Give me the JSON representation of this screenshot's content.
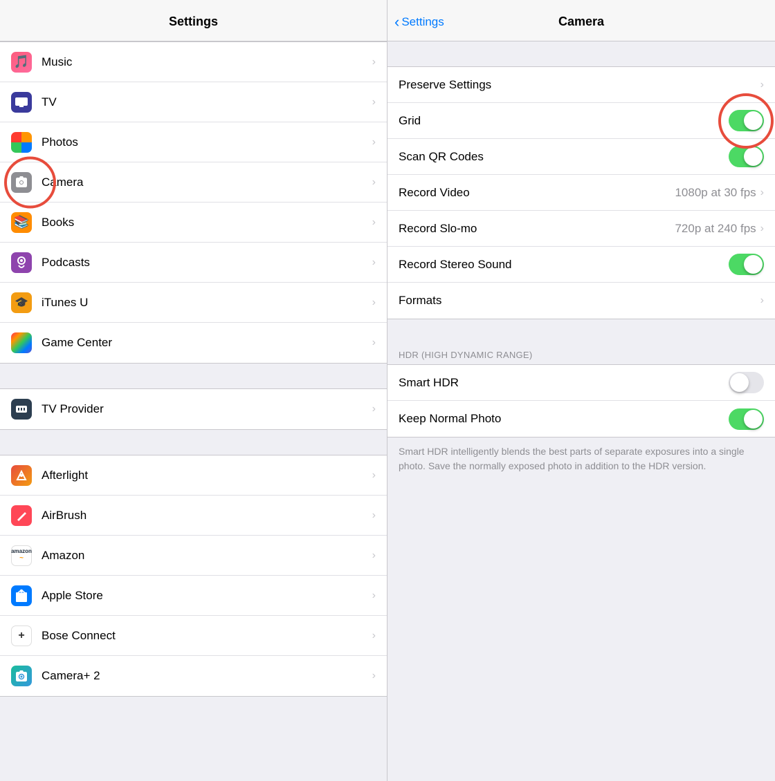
{
  "left": {
    "header": "Settings",
    "items": [
      {
        "id": "music",
        "label": "Music",
        "iconType": "music",
        "iconEmoji": "🎵"
      },
      {
        "id": "tv",
        "label": "TV",
        "iconType": "tv",
        "iconEmoji": "📺"
      },
      {
        "id": "photos",
        "label": "Photos",
        "iconType": "photos",
        "iconEmoji": ""
      },
      {
        "id": "camera",
        "label": "Camera",
        "iconType": "camera",
        "iconEmoji": "📷"
      },
      {
        "id": "books",
        "label": "Books",
        "iconType": "books",
        "iconEmoji": "📚"
      },
      {
        "id": "podcasts",
        "label": "Podcasts",
        "iconType": "podcasts",
        "iconEmoji": "🎙"
      },
      {
        "id": "itunes",
        "label": "iTunes U",
        "iconType": "itunes",
        "iconEmoji": "🎓"
      },
      {
        "id": "gamecenter",
        "label": "Game Center",
        "iconType": "gamecenter",
        "iconEmoji": ""
      }
    ],
    "section2": [
      {
        "id": "tvprovider",
        "label": "TV Provider",
        "iconType": "tvprovider",
        "iconEmoji": "📡"
      }
    ],
    "section3": [
      {
        "id": "afterlight",
        "label": "Afterlight",
        "iconType": "afterlight",
        "iconEmoji": ""
      },
      {
        "id": "airbrush",
        "label": "AirBrush",
        "iconType": "airbrush",
        "iconEmoji": ""
      },
      {
        "id": "amazon",
        "label": "Amazon",
        "iconType": "amazon",
        "iconEmoji": ""
      },
      {
        "id": "applestore",
        "label": "Apple Store",
        "iconType": "applestore",
        "iconEmoji": "🛍"
      },
      {
        "id": "bose",
        "label": "Bose Connect",
        "iconType": "bose",
        "iconEmoji": "+"
      },
      {
        "id": "camera2",
        "label": "Camera+ 2",
        "iconType": "camera2",
        "iconEmoji": ""
      }
    ]
  },
  "right": {
    "header": "Camera",
    "back_label": "Settings",
    "section1": [
      {
        "id": "preserve",
        "label": "Preserve Settings",
        "type": "chevron",
        "value": ""
      },
      {
        "id": "grid",
        "label": "Grid",
        "type": "toggle",
        "value": true
      },
      {
        "id": "scanqr",
        "label": "Scan QR Codes",
        "type": "toggle",
        "value": true
      },
      {
        "id": "recordvideo",
        "label": "Record Video",
        "type": "value-chevron",
        "value": "1080p at 30 fps"
      },
      {
        "id": "recordslomo",
        "label": "Record Slo-mo",
        "type": "value-chevron",
        "value": "720p at 240 fps"
      },
      {
        "id": "recordstereo",
        "label": "Record Stereo Sound",
        "type": "toggle",
        "value": true
      },
      {
        "id": "formats",
        "label": "Formats",
        "type": "chevron",
        "value": ""
      }
    ],
    "hdr_header": "HDR (HIGH DYNAMIC RANGE)",
    "section2": [
      {
        "id": "smarthdr",
        "label": "Smart HDR",
        "type": "toggle",
        "value": false
      },
      {
        "id": "keepnormal",
        "label": "Keep Normal Photo",
        "type": "toggle",
        "value": true
      }
    ],
    "hdr_description": "Smart HDR intelligently blends the best parts of separate exposures into a single photo. Save the normally exposed photo in addition to the HDR version."
  }
}
